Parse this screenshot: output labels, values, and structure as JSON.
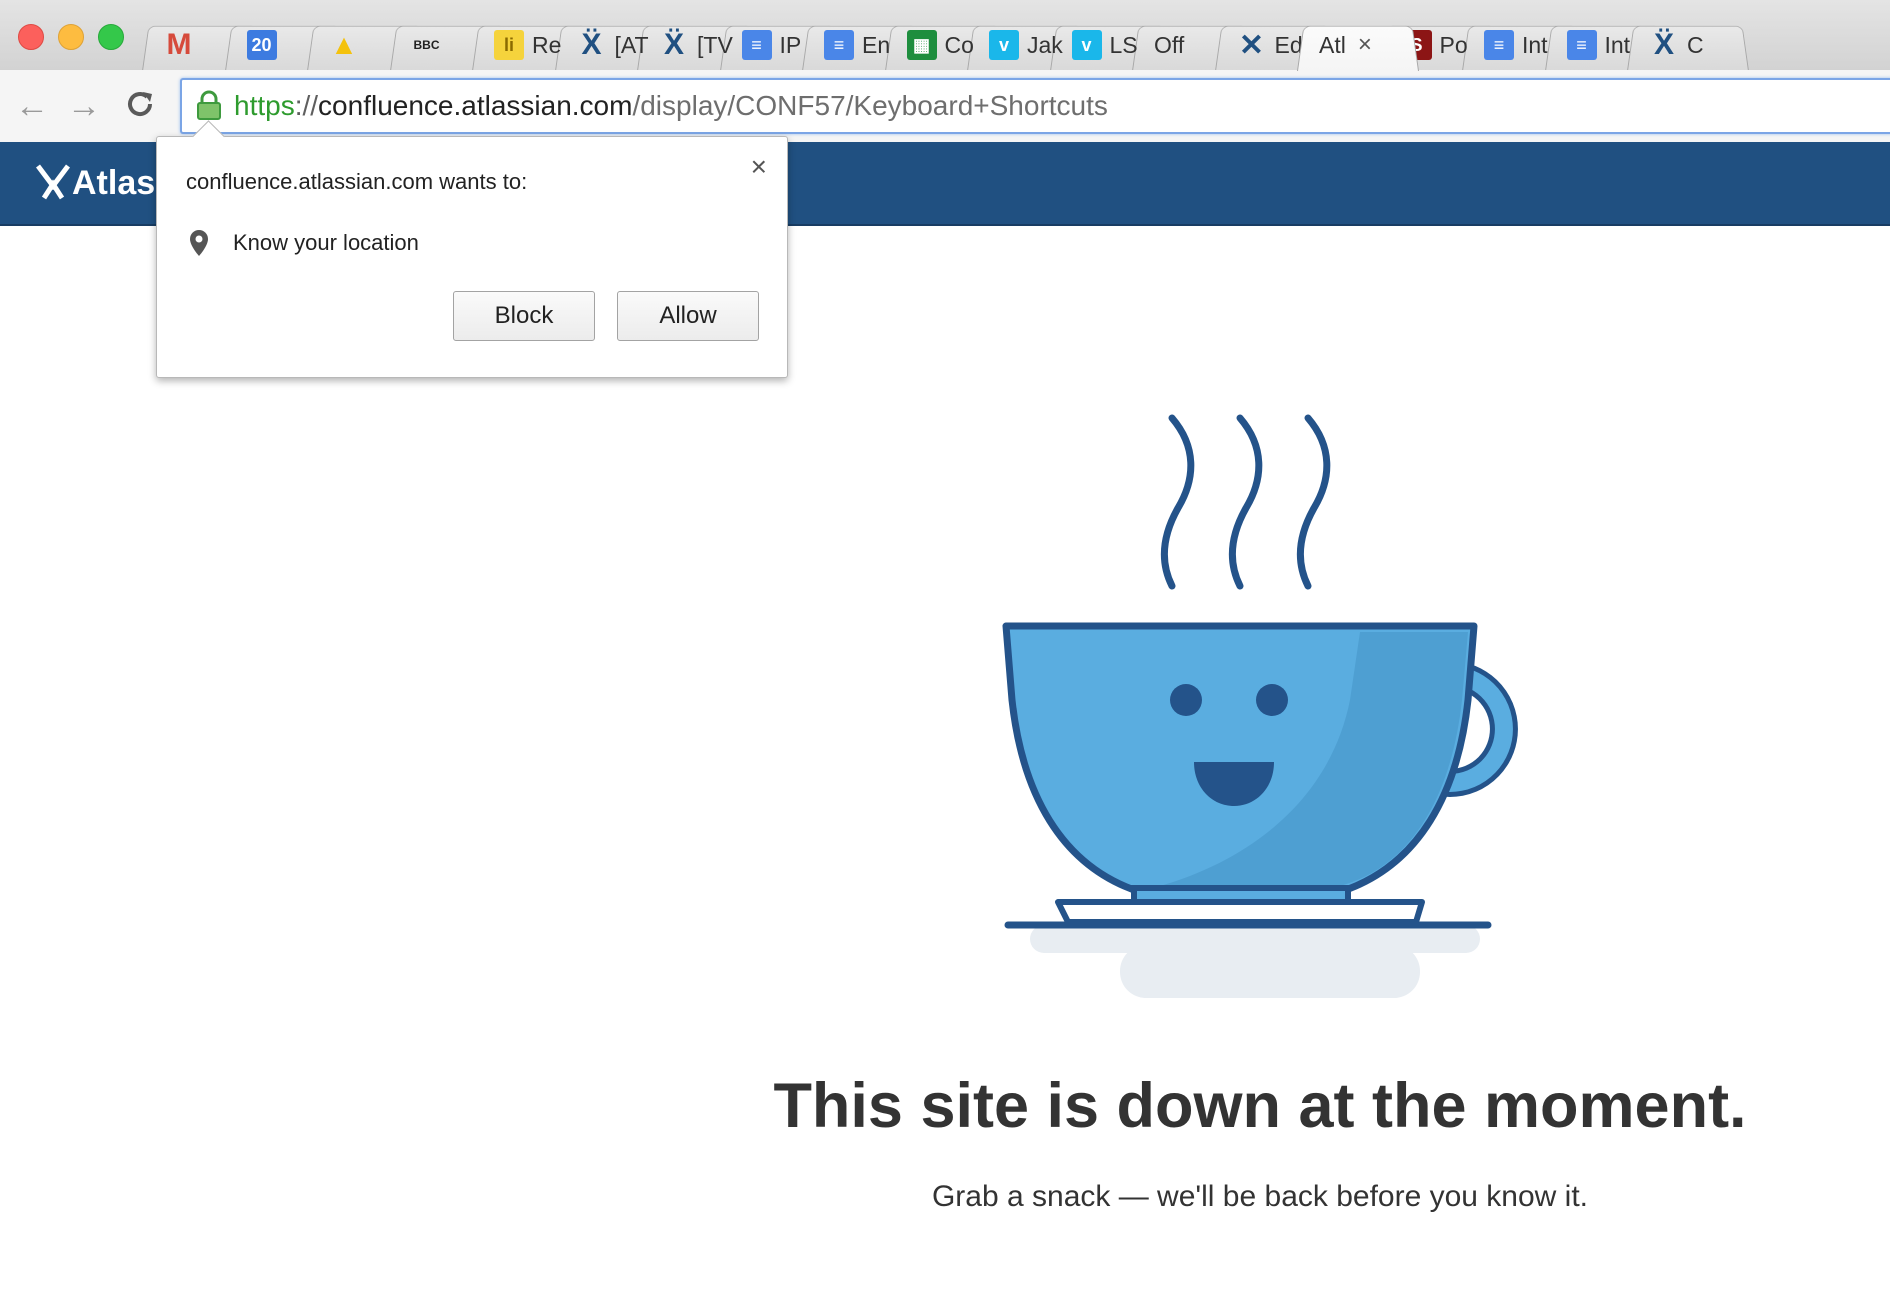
{
  "window": {
    "tabs": [
      {
        "label": "",
        "icon": "gmail-icon",
        "active": false
      },
      {
        "label": "",
        "icon": "calendar-icon",
        "badge": "20",
        "active": false
      },
      {
        "label": "",
        "icon": "drive-icon",
        "active": false
      },
      {
        "label": "",
        "icon": "bbc-icon",
        "badge": "BBC",
        "active": false
      },
      {
        "label": "Re",
        "icon": "readability-icon",
        "active": false
      },
      {
        "label": "[AT",
        "icon": "jira-icon",
        "active": false
      },
      {
        "label": "[TV",
        "icon": "jira-icon",
        "active": false
      },
      {
        "label": "IP",
        "icon": "docs-icon",
        "active": false
      },
      {
        "label": "En",
        "icon": "docs-icon",
        "active": false
      },
      {
        "label": "Co",
        "icon": "sheets-icon",
        "active": false
      },
      {
        "label": "Jak",
        "icon": "vimeo-icon",
        "active": false
      },
      {
        "label": "LS",
        "icon": "vimeo-icon",
        "active": false
      },
      {
        "label": "Off",
        "icon": "",
        "active": false
      },
      {
        "label": "Ed",
        "icon": "confluence-icon",
        "active": false
      },
      {
        "label": "Atl",
        "icon": "",
        "active": true
      },
      {
        "label": "Po",
        "icon": "stanford-icon",
        "active": false
      },
      {
        "label": "Int",
        "icon": "docs-icon",
        "active": false
      },
      {
        "label": "Int",
        "icon": "docs-icon",
        "active": false
      },
      {
        "label": "C",
        "icon": "jira-icon",
        "active": false
      }
    ]
  },
  "toolbar": {
    "url": {
      "scheme": "https",
      "sep": "://",
      "host": "confluence.atlassian.com",
      "path": "/display/CONF57/Keyboard+Shortcuts"
    }
  },
  "site": {
    "logo": "Atlass"
  },
  "permission": {
    "title": "confluence.atlassian.com wants to:",
    "request": "Know your location",
    "block_label": "Block",
    "allow_label": "Allow",
    "close_glyph": "×"
  },
  "page": {
    "headline": "This site is down at the moment.",
    "subline": "Grab a snack — we'll be back before you know it."
  },
  "colors": {
    "header": "#205081",
    "cup": "#5aade0",
    "outline": "#24538a"
  }
}
